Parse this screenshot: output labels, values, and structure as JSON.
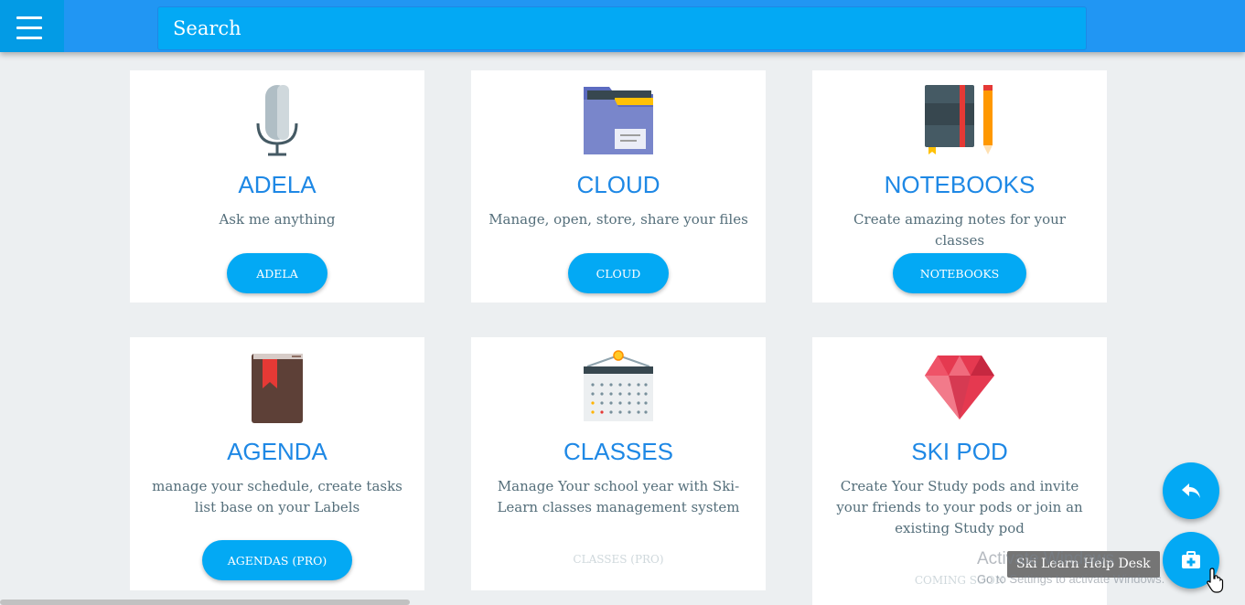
{
  "header": {
    "search_placeholder": "Search",
    "menu_icon": "hamburger-menu-icon",
    "bar_color": "#2196f3",
    "accent": "#03a9f4"
  },
  "cards": [
    {
      "icon": "microphone-icon",
      "title": "ADELA",
      "description": "Ask me anything",
      "button": "ADELA"
    },
    {
      "icon": "folder-icon",
      "title": "CLOUD",
      "description": "Manage, open, store, share your files",
      "button": "CLOUD"
    },
    {
      "icon": "notebook-pencil-icon",
      "title": "NOTEBOOKS",
      "description": "Create amazing notes for your classes",
      "button": "NOTEBOOKS"
    },
    {
      "icon": "book-bookmark-icon",
      "title": "AGENDA",
      "description": "manage your schedule, create tasks list base on your Labels",
      "button": "AGENDAS (PRO)"
    },
    {
      "icon": "calendar-icon",
      "title": "CLASSES",
      "description": "Manage Your school year with Ski-Learn classes management system",
      "button": "CLASSES (PRO)"
    },
    {
      "icon": "diamond-gem-icon",
      "title": "SKI POD",
      "description": "Create Your Study pods and invite your friends to your pods or join an existing Study pod",
      "button": "COMING SOON"
    }
  ],
  "fabs": {
    "back_icon": "reply-arrow-icon",
    "help_icon": "first-aid-kit-icon",
    "help_tooltip": "Ski Learn Help Desk"
  },
  "watermark": {
    "line1": "Activate Windows",
    "line2": "Go to Settings to activate Windows."
  }
}
